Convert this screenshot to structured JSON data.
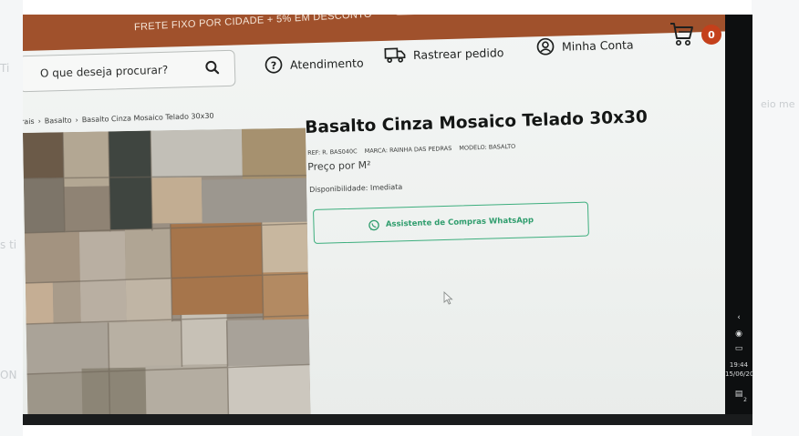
{
  "promo": {
    "text": "FRETE FIXO POR CIDADE + 5% EM DESCONTO"
  },
  "search": {
    "placeholder": "O que deseja procurar?"
  },
  "nav": {
    "support": "Atendimento",
    "track": "Rastrear pedido",
    "account": "Minha Conta"
  },
  "cart": {
    "count": "0"
  },
  "breadcrumb": [
    "rais",
    "Basalto",
    "Basalto Cinza Mosaico Telado 30x30"
  ],
  "product": {
    "title": "Basalto Cinza Mosaico Telado 30x30",
    "ref": "REF: R. BAS040C",
    "brand": "MARCA: RAINHA DAS PEDRAS",
    "model": "MODELO: BASALTO",
    "price_label": "Preço por M²",
    "availability_label": "Disponibilidade:",
    "availability_value": "Imediata",
    "whatsapp_button": "Assistente de Compras WhatsApp"
  },
  "system": {
    "time": "19:44",
    "date": "15/06/20",
    "notifications": "2"
  },
  "colors": {
    "promo_bar": "#a0512c",
    "cart_badge": "#c4401b",
    "whatsapp_green": "#3cae7d"
  },
  "icons": [
    "search-icon",
    "help-circle-icon",
    "truck-icon",
    "user-circle-icon",
    "shopping-cart-icon",
    "whatsapp-icon",
    "mouse-cursor-icon"
  ]
}
